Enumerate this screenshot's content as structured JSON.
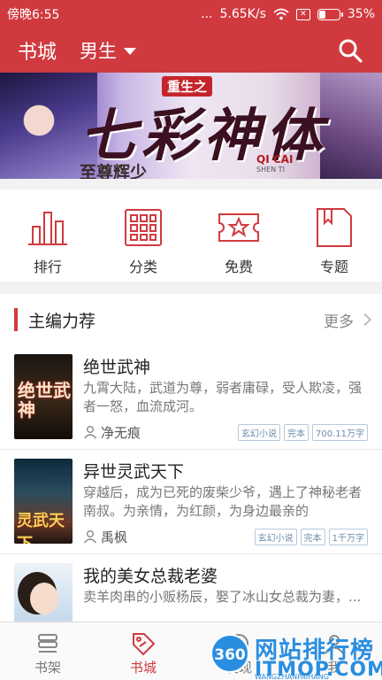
{
  "status_bar": {
    "time": "傍晚6:55",
    "network_speed": "5.65K/s",
    "battery": "35%",
    "battery_level": 0.35,
    "dots": "..."
  },
  "app_bar": {
    "title": "书城",
    "channel": "男生",
    "icons": [
      "search-icon",
      "chevron-down-icon"
    ]
  },
  "banner": {
    "seal": "重生之",
    "title": "七彩神体",
    "pinyin": "QI CAI",
    "pinyin2": "SHEN TI",
    "subtitle": "至尊辉少"
  },
  "nav": [
    {
      "label": "排行",
      "icon": "ranking-bars-icon"
    },
    {
      "label": "分类",
      "icon": "category-grid-icon"
    },
    {
      "label": "免费",
      "icon": "free-ticket-icon"
    },
    {
      "label": "专题",
      "icon": "topic-book-icon"
    }
  ],
  "section": {
    "title": "主编力荐",
    "more": "更多"
  },
  "books": [
    {
      "name": "绝世武神",
      "desc": "九霄大陆，武道为尊，弱者庸碌，受人欺凌，强者一怒，血流成河。",
      "author": "净无痕",
      "tags": [
        "玄幻小说",
        "完本",
        "700.11万字"
      ],
      "cover_text": "绝世武神"
    },
    {
      "name": "异世灵武天下",
      "desc": "穿越后，成为已死的废柴少爷，遇上了神秘老者南叔。为亲情，为红颜，为身边最亲的",
      "author": "禹枫",
      "tags": [
        "玄幻小说",
        "完本",
        "1千万字"
      ],
      "cover_text": "灵武天下"
    },
    {
      "name": "我的美女总裁老婆",
      "desc": "卖羊肉串的小贩杨辰，娶了冰山女总裁为妻，...",
      "author": "",
      "tags": [],
      "cover_text": ""
    }
  ],
  "tab_bar": [
    {
      "label": "书架",
      "icon": "bookshelf-icon"
    },
    {
      "label": "书城",
      "icon": "store-tag-icon"
    },
    {
      "label": "发现",
      "icon": "discover-icon"
    },
    {
      "label": "我",
      "icon": "profile-icon"
    }
  ],
  "watermark": {
    "logo": "360",
    "line1": "网站排行榜",
    "line2": "ITMOP.COM",
    "line3": "WANGZHANPAIHANG"
  },
  "colors": {
    "brand": "#d03a3f",
    "tag_text": "#6a8bad"
  }
}
